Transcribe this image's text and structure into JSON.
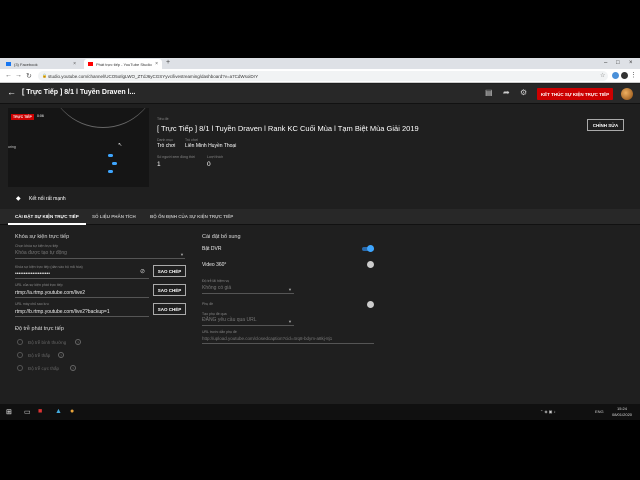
{
  "browser": {
    "tabs": [
      {
        "label": "(3) Facebook",
        "active": false
      },
      {
        "label": "Phát trực tiếp - YouTube Studio",
        "active": true
      }
    ],
    "address": "studio.youtube.com/channel/UCO5oIlgLWO_ZTdJ6yCGSYyvc/livestreaming/dashboard?v=a7CdWsoiDrY"
  },
  "header": {
    "title": "[ Trực Tiếp ] 8/1 l Tuyền Draven l...",
    "end_button": "KẾT THÚC SỰ KIỆN TRỰC TIẾP"
  },
  "preview": {
    "badge": "TRỰC TIẾP",
    "viewer_count": "0:06",
    "side_text": "uring",
    "connection": "Kết nối rất mạnh"
  },
  "info": {
    "title_label": "Tiêu đề",
    "title": "[ Trực Tiếp ] 8/1 l Tuyền Draven l Rank KC Cuối Mùa l Tạm Biệt Mùa Giải 2019",
    "category_label": "Danh mục",
    "category": "Trò chơi",
    "game_label": "Trò chơi",
    "game": "Liên Minh Huyền Thoại",
    "watching_label": "Số người xem đồng thời",
    "watching": "1",
    "likes_label": "Lượt thích",
    "likes": "0",
    "edit_button": "CHỈNH SỬA"
  },
  "tabs": [
    {
      "label": "CÀI ĐẶT SỰ KIỆN TRỰC TIẾP",
      "active": true
    },
    {
      "label": "SỐ LIỆU PHÂN TÍCH",
      "active": false
    },
    {
      "label": "BỘ ỔN ĐỊNH CỦA SỰ KIỆN TRỰC TIẾP",
      "active": false
    }
  ],
  "settings": {
    "stream_key_title": "Khóa sự kiện trực tiếp",
    "key_select_label": "Chọn khóa sự kiện trực tiếp",
    "key_select_value": "Khóa được tạo tự động",
    "key_field_label": "Khóa sự kiện trực tiếp (dán vào bộ mã hóa)",
    "key_field_value": "••••••••••••••••••••",
    "copy_label": "SAO CHÉP",
    "url_label": "URL của sự kiện phát trực tiếp",
    "url_value": "rtmp://a.rtmp.youtube.com/live2",
    "backup_label": "URL máy chủ sao lưu",
    "backup_value": "rtmp://b.rtmp.youtube.com/live2?backup=1",
    "latency_title": "Độ trễ phát trực tiếp",
    "latency_options": [
      "Độ trễ bình thường",
      "Độ trễ thấp",
      "Độ trễ cực thấp"
    ],
    "extra_title": "Cài đặt bổ sung",
    "dvr_label": "Bật DVR",
    "video360_label": "Video 360°",
    "delay_label": "Độ trễ lãi hiệm vụ",
    "delay_value": "Không có giá",
    "unlisted_label": "Phụ đề",
    "unlisted_sub_label": "Tạo phụ đề qua",
    "unlisted_value": "ĐĂNG yêu cầu qua URL",
    "url_sub_label": "URL trước dẫn phụ đề",
    "url_sub_value": "http://upload.youtube.com/closedcaption?cid=4rq8-bdym-a8kj-8j1"
  },
  "taskbar": {
    "time": "15:24",
    "date": "08/01/2020",
    "lang": "ENG"
  },
  "colors": {
    "accent_red": "#cc0000",
    "toggle_blue": "#3ea6ff",
    "background": "#1f1f1f"
  }
}
